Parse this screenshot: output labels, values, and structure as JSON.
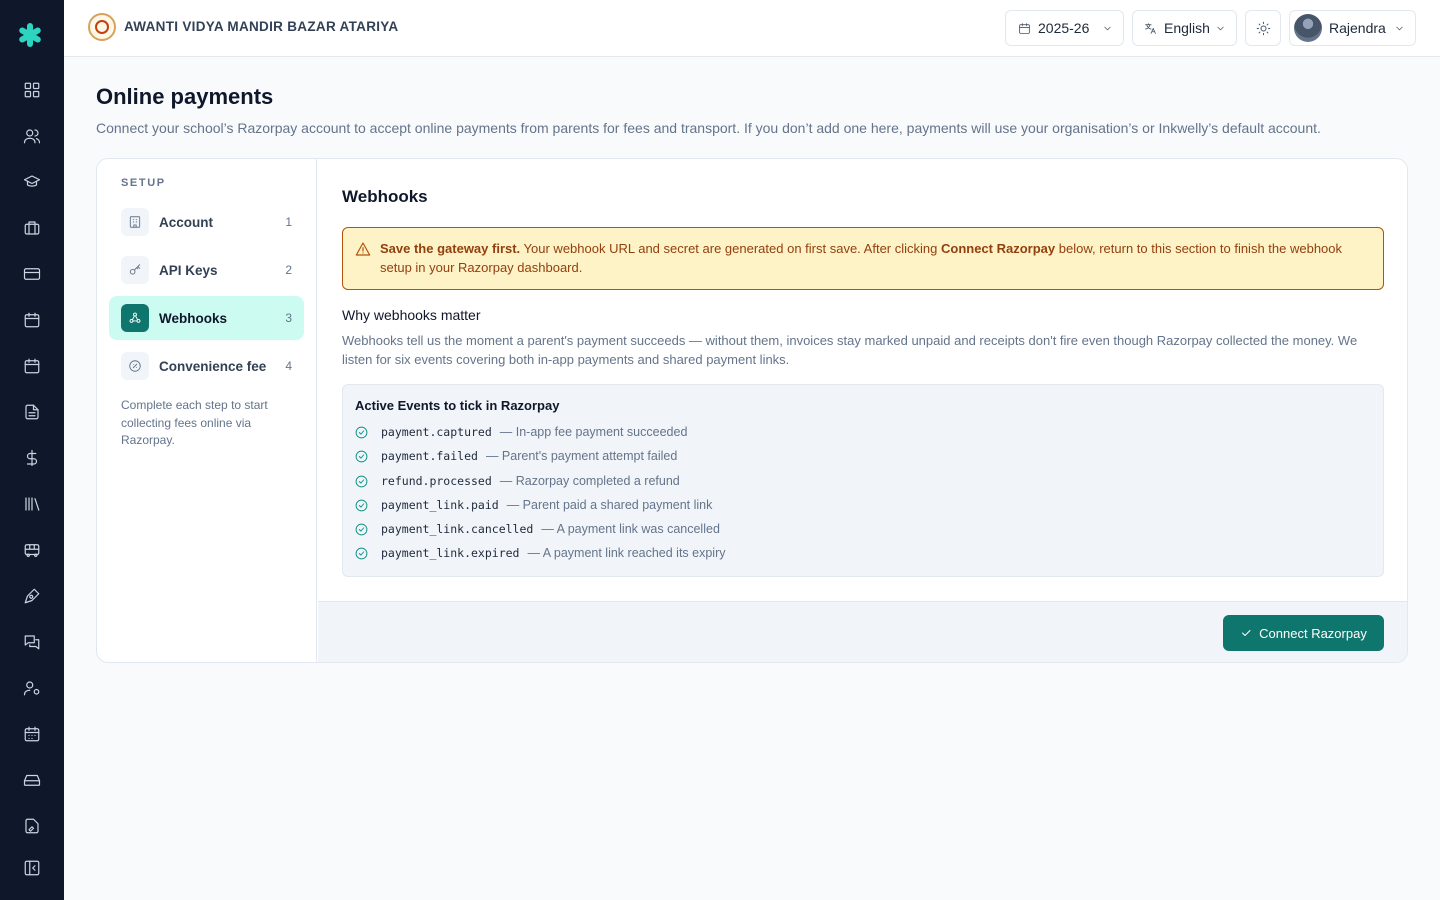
{
  "rail": {
    "icons": [
      "logo-icon",
      "dashboard-icon",
      "users-icon",
      "graduation-cap-icon",
      "briefcase-icon",
      "credit-card-icon",
      "calendar-icon",
      "calendar-icon",
      "document-icon",
      "dollar-icon",
      "library-icon",
      "bus-icon",
      "pen-tool-icon",
      "messages-icon",
      "user-settings-icon",
      "calendar-grid-icon",
      "drive-icon",
      "file-signature-icon",
      "collapse-sidebar-icon"
    ]
  },
  "topbar": {
    "school_name": "AWANTI VIDYA MANDIR BAZAR ATARIYA",
    "year": "2025-26",
    "language": "English",
    "user": "Rajendra"
  },
  "page": {
    "title": "Online payments",
    "description": "Connect your school’s Razorpay account to accept online payments from parents for fees and transport. If you don’t add one here, payments will use your organisation’s or Inkwelly’s default account."
  },
  "steps": {
    "heading": "SETUP",
    "items": [
      {
        "label": "Account",
        "num": "1",
        "icon": "building-icon"
      },
      {
        "label": "API Keys",
        "num": "2",
        "icon": "key-icon"
      },
      {
        "label": "Webhooks",
        "num": "3",
        "icon": "webhook-icon",
        "active": true
      },
      {
        "label": "Convenience fee",
        "num": "4",
        "icon": "percent-badge-icon"
      }
    ],
    "note": "Complete each step to start collecting fees online via Razorpay."
  },
  "webhooks": {
    "title": "Webhooks",
    "alert": {
      "strong": "Save the gateway first.",
      "text1": " Your webhook URL and secret are generated on first save. After clicking ",
      "strong2": "Connect Razorpay",
      "text2": " below, return to this section to finish the webhook setup in your Razorpay dashboard."
    },
    "why_title": "Why webhooks matter",
    "why_desc": "Webhooks tell us the moment a parent's payment succeeds — without them, invoices stay marked unpaid and receipts don't fire even though Razorpay collected the money. We listen for six events covering both in-app payments and shared payment links.",
    "events_title": "Active Events to tick in Razorpay",
    "events": [
      {
        "code": "payment.captured",
        "desc": "— In-app fee payment succeeded"
      },
      {
        "code": "payment.failed",
        "desc": "— Parent's payment attempt failed"
      },
      {
        "code": "refund.processed",
        "desc": "— Razorpay completed a refund"
      },
      {
        "code": "payment_link.paid",
        "desc": "— Parent paid a shared payment link"
      },
      {
        "code": "payment_link.cancelled",
        "desc": "— A payment link was cancelled"
      },
      {
        "code": "payment_link.expired",
        "desc": "— A payment link reached its expiry"
      }
    ],
    "connect_button": "Connect Razorpay"
  },
  "colors": {
    "rail_bg": "#0f172a",
    "accent": "#0f766e",
    "active_step_bg": "#ccfbf1",
    "alert_bg": "#fef3c7",
    "alert_border": "#b45309"
  }
}
